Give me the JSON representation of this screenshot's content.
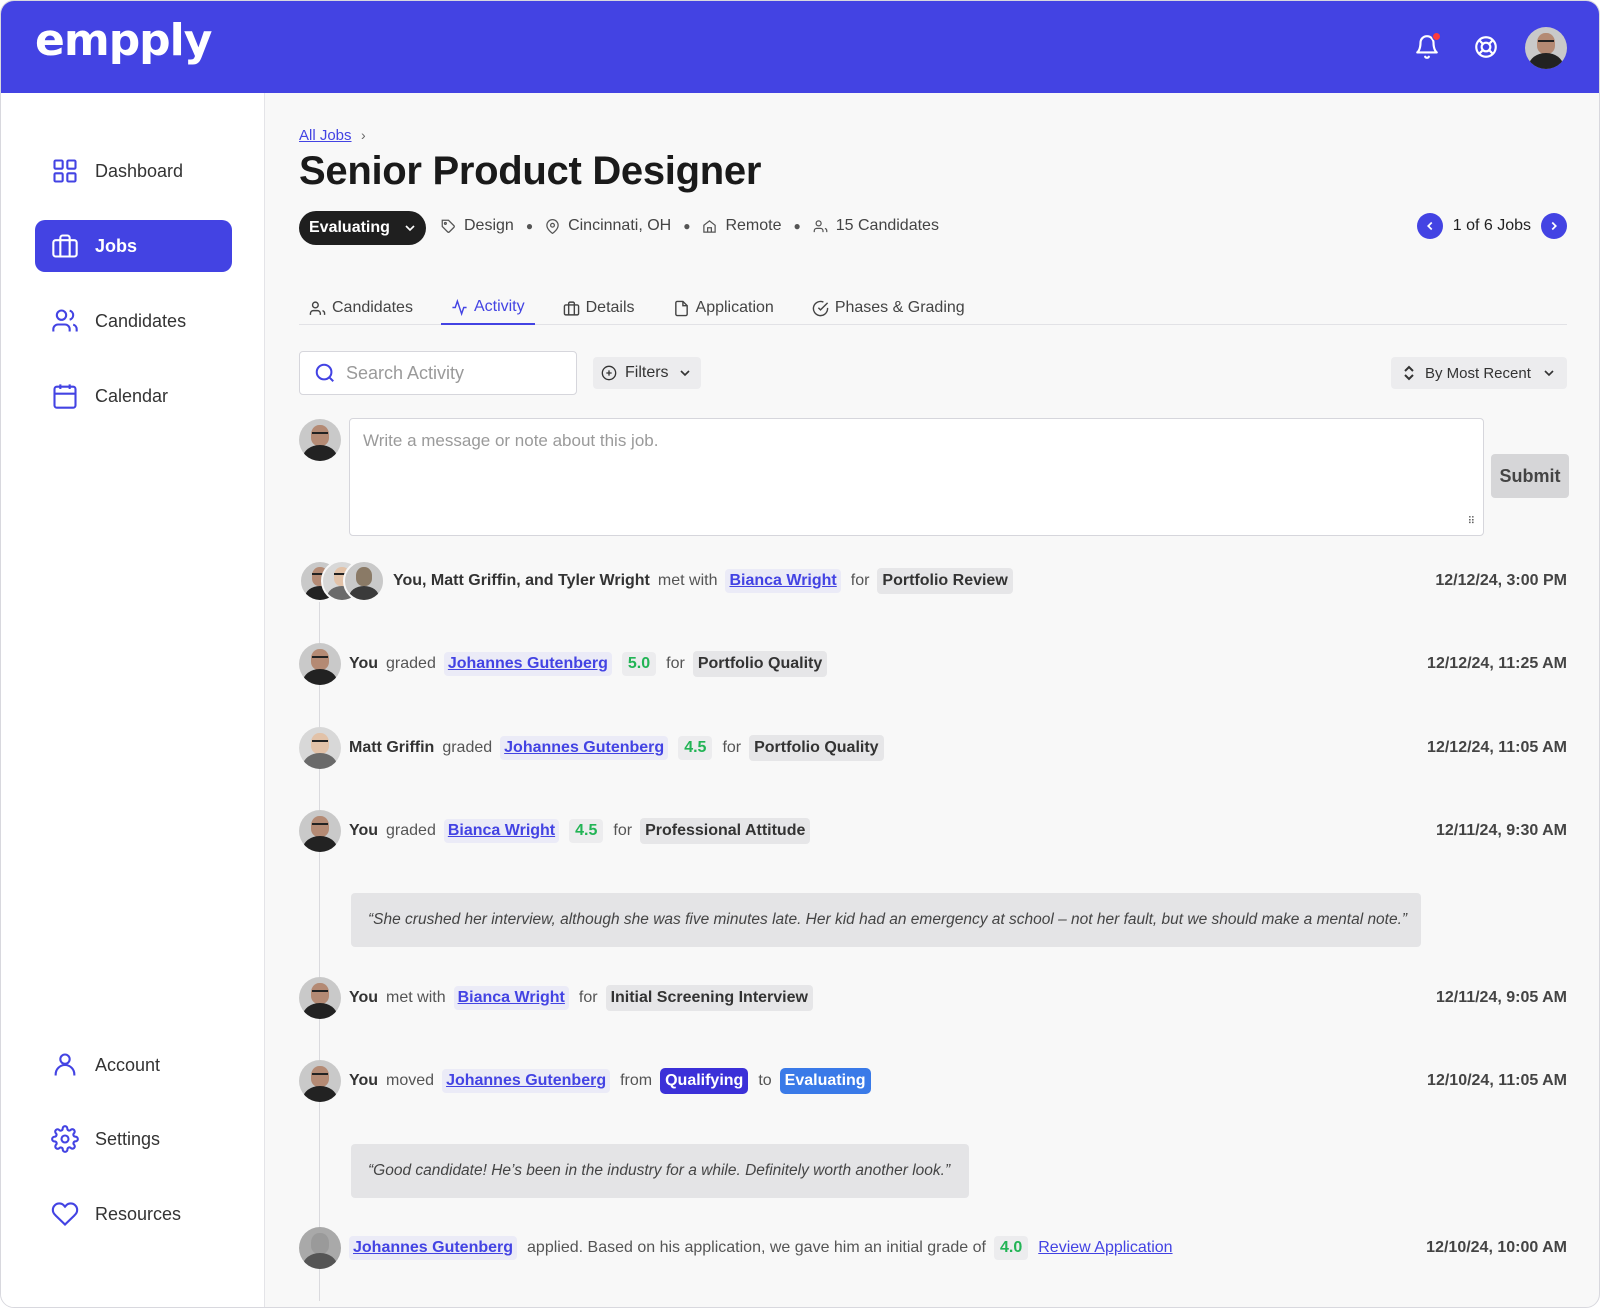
{
  "app": {
    "logo": "empply"
  },
  "sidebar": {
    "items": [
      {
        "label": "Dashboard",
        "icon": "grid-icon"
      },
      {
        "label": "Jobs",
        "icon": "briefcase-icon",
        "active": true
      },
      {
        "label": "Candidates",
        "icon": "users-icon"
      },
      {
        "label": "Calendar",
        "icon": "calendar-icon"
      }
    ],
    "bottom_items": [
      {
        "label": "Account",
        "icon": "user-icon"
      },
      {
        "label": "Settings",
        "icon": "gear-icon"
      },
      {
        "label": "Resources",
        "icon": "heart-icon"
      }
    ]
  },
  "header": {
    "breadcrumb": "All Jobs",
    "breadcrumb_sep": "›",
    "title": "Senior Product Designer",
    "status": "Evaluating",
    "meta": {
      "department": "Design",
      "location": "Cincinnati, OH",
      "work_type": "Remote",
      "candidates": "15 Candidates"
    },
    "pager": "1 of 6 Jobs"
  },
  "tabs": [
    {
      "label": "Candidates",
      "icon": "users-icon"
    },
    {
      "label": "Activity",
      "icon": "activity-icon",
      "active": true
    },
    {
      "label": "Details",
      "icon": "briefcase-icon"
    },
    {
      "label": "Application",
      "icon": "file-icon"
    },
    {
      "label": "Phases & Grading",
      "icon": "check-circle-icon"
    }
  ],
  "toolbar": {
    "search_placeholder": "Search Activity",
    "filters_label": "Filters",
    "sort_label": "By Most Recent"
  },
  "compose": {
    "placeholder": "Write a message or note about this job.",
    "submit_label": "Submit"
  },
  "activity": [
    {
      "who": "You, Matt Griffin, and Tyler Wright",
      "verb": "met with",
      "candidate": "Bianca Wright",
      "for": "for",
      "tag": "Portfolio Review",
      "time": "12/12/24, 3:00 PM"
    },
    {
      "who": "You",
      "verb": "graded",
      "candidate": "Johannes Gutenberg",
      "grade": "5.0",
      "for": "for",
      "tag": "Portfolio Quality",
      "time": "12/12/24, 11:25 AM"
    },
    {
      "who": "Matt Griffin",
      "verb": "graded",
      "candidate": "Johannes Gutenberg",
      "grade": "4.5",
      "for": "for",
      "tag": "Portfolio Quality",
      "time": "12/12/24, 11:05 AM"
    },
    {
      "who": "You",
      "verb": "graded",
      "candidate": "Bianca Wright",
      "grade": "4.5",
      "for": "for",
      "tag": "Professional Attitude",
      "time": "12/11/24, 9:30 AM",
      "note": "“She crushed her interview, although she was five minutes late. Her kid had an emergency at school – not her fault, but we should make a mental note.”"
    },
    {
      "who": "You",
      "verb": "met with",
      "candidate": "Bianca Wright",
      "for": "for",
      "tag": "Initial Screening Interview",
      "time": "12/11/24, 9:05 AM"
    },
    {
      "who": "You",
      "verb": "moved",
      "candidate": "Johannes Gutenberg",
      "from": "from",
      "from_stage": "Qualifying",
      "to": "to",
      "to_stage": "Evaluating",
      "time": "12/10/24, 11:05 AM",
      "note": "“Good candidate! He’s been in the industry for a while. Definitely worth another look.”"
    },
    {
      "candidate": "Johannes Gutenberg",
      "text": "applied. Based on his application, we gave him an initial grade of",
      "grade": "4.0",
      "link": "Review Application",
      "time": "12/10/24, 10:00 AM"
    }
  ],
  "colors": {
    "brand": "#4343e3",
    "grade_green": "#22b455",
    "stage_qualifying": "#3b30d8",
    "stage_evaluating": "#3a7ae8"
  }
}
